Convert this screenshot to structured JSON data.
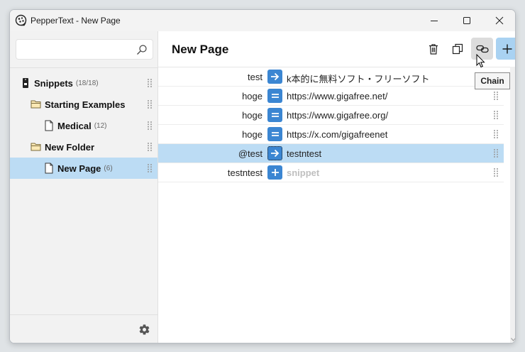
{
  "window": {
    "title": "PepperText - New Page"
  },
  "sidebar": {
    "search": {
      "value": "",
      "placeholder": ""
    },
    "tree": [
      {
        "label": "Snippets",
        "count": "(18/18)",
        "icon": "phone-icon",
        "level": 0
      },
      {
        "label": "Starting Examples",
        "count": "",
        "icon": "folder-icon",
        "level": 1
      },
      {
        "label": "Medical",
        "count": "(12)",
        "icon": "page-icon",
        "level": 2
      },
      {
        "label": "New Folder",
        "count": "",
        "icon": "folder-icon",
        "level": 1
      },
      {
        "label": "New Page",
        "count": "(6)",
        "icon": "page-icon",
        "level": 2,
        "selected": true
      }
    ],
    "settings_icon": "gear-icon"
  },
  "main": {
    "page_title": "New Page",
    "toolbar": {
      "delete_icon": "trash-icon",
      "copy_icon": "copy-icon",
      "chain_icon": "chain-icon",
      "add_icon": "plus-icon"
    },
    "rows": [
      {
        "key": "test",
        "op": "arrow",
        "value": "k本的に無料ソフト・フリーソフト",
        "placeholder": false,
        "selected": false
      },
      {
        "key": "hoge",
        "op": "equals",
        "value": "https://www.gigafree.net/",
        "placeholder": false,
        "selected": false
      },
      {
        "key": "hoge",
        "op": "equals",
        "value": "https://www.gigafree.org/",
        "placeholder": false,
        "selected": false
      },
      {
        "key": "hoge",
        "op": "equals",
        "value": "https://x.com/gigafreenet",
        "placeholder": false,
        "selected": false
      },
      {
        "key": "@test",
        "op": "arrow",
        "value": "testntest",
        "placeholder": false,
        "selected": true
      },
      {
        "key": "testntest",
        "op": "plus",
        "value": "snippet",
        "placeholder": true,
        "selected": false
      }
    ]
  },
  "tooltip": {
    "text": "Chain"
  },
  "colors": {
    "accent": "#3b86d2",
    "selection": "#bcdcf4",
    "primary_button": "#a9d2f2"
  }
}
